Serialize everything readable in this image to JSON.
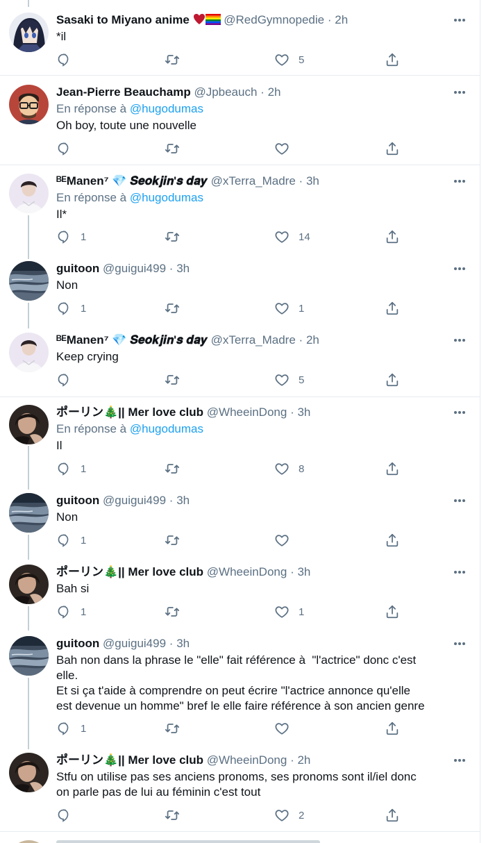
{
  "tweets": [
    {
      "name": "Sasaki to Miyano anime",
      "name_emoji": "heart-and-rainbow-flag",
      "handle": "@RedGymnopedie",
      "time": "2h",
      "reply_label": "",
      "mention": "",
      "text": "*il",
      "replies": "",
      "retweets": "",
      "likes": "5",
      "avatar": "anime-avatar"
    },
    {
      "name": "Jean-Pierre Beauchamp",
      "name_emoji": "",
      "handle": "@Jpbeauch",
      "time": "2h",
      "reply_label": "En réponse à",
      "mention": "@hugodumas",
      "text": "Oh boy, toute une nouvelle",
      "replies": "",
      "retweets": "",
      "likes": "",
      "avatar": "cartoon-avatar"
    },
    {
      "name": "ᴮᴱManen⁷ 💎 𝑺𝒆𝒐𝒌𝒋𝒊𝒏'𝒔 𝒅𝒂𝒚",
      "name_emoji": "",
      "handle": "@xTerra_Madre",
      "time": "3h",
      "reply_label": "En réponse à",
      "mention": "@hugodumas",
      "text": "Il*",
      "replies": "1",
      "retweets": "",
      "likes": "14",
      "avatar": "portrait-avatar"
    },
    {
      "name": "guitoon",
      "name_emoji": "",
      "handle": "@guigui499",
      "time": "3h",
      "reply_label": "",
      "mention": "",
      "text": "Non",
      "replies": "1",
      "retweets": "",
      "likes": "1",
      "avatar": "seascape-avatar"
    },
    {
      "name": "ᴮᴱManen⁷ 💎 𝑺𝒆𝒐𝒌𝒋𝒊𝒏'𝒔 𝒅𝒂𝒚",
      "name_emoji": "",
      "handle": "@xTerra_Madre",
      "time": "2h",
      "reply_label": "",
      "mention": "",
      "text": "Keep crying",
      "replies": "",
      "retweets": "",
      "likes": "5",
      "avatar": "portrait-avatar"
    },
    {
      "name": "ポーリン🎄|| Mer love club",
      "name_emoji": "",
      "handle": "@WheeinDong",
      "time": "3h",
      "reply_label": "En réponse à",
      "mention": "@hugodumas",
      "text": "Il",
      "replies": "1",
      "retweets": "",
      "likes": "8",
      "avatar": "dark-photo-avatar"
    },
    {
      "name": "guitoon",
      "name_emoji": "",
      "handle": "@guigui499",
      "time": "3h",
      "reply_label": "",
      "mention": "",
      "text": "Non",
      "replies": "1",
      "retweets": "",
      "likes": "",
      "avatar": "seascape-avatar"
    },
    {
      "name": "ポーリン🎄|| Mer love club",
      "name_emoji": "",
      "handle": "@WheeinDong",
      "time": "3h",
      "reply_label": "",
      "mention": "",
      "text": "Bah si",
      "replies": "1",
      "retweets": "",
      "likes": "1",
      "avatar": "dark-photo-avatar"
    },
    {
      "name": "guitoon",
      "name_emoji": "",
      "handle": "@guigui499",
      "time": "3h",
      "reply_label": "",
      "mention": "",
      "text": "Bah non dans la phrase le \"elle\" fait référence à  \"l'actrice\" donc c'est\nelle.\nEt si ça t'aide à comprendre on peut écrire \"l'actrice annonce qu'elle\nest devenue un homme\" bref le elle faire référence à son ancien genre",
      "replies": "1",
      "retweets": "",
      "likes": "",
      "avatar": "seascape-avatar"
    },
    {
      "name": "ポーリン🎄|| Mer love club",
      "name_emoji": "",
      "handle": "@WheeinDong",
      "time": "2h",
      "reply_label": "",
      "mention": "",
      "text": "Stfu on utilise pas ses anciens pronoms, ses pronoms sont il/iel donc\non parle pas de lui au féminin c'est tout",
      "replies": "",
      "retweets": "",
      "likes": "2",
      "avatar": "dark-photo-avatar"
    }
  ],
  "separator": "·",
  "icons": {
    "reply": "reply-icon",
    "retweet": "retweet-icon",
    "like": "heart-icon",
    "share": "share-icon",
    "more": "more-icon"
  },
  "colors": {
    "text": "#0f1419",
    "secondary": "#5b7083",
    "link": "#1da1f2",
    "thread_line": "#c4cfd6",
    "divider": "#e6ecf0"
  }
}
